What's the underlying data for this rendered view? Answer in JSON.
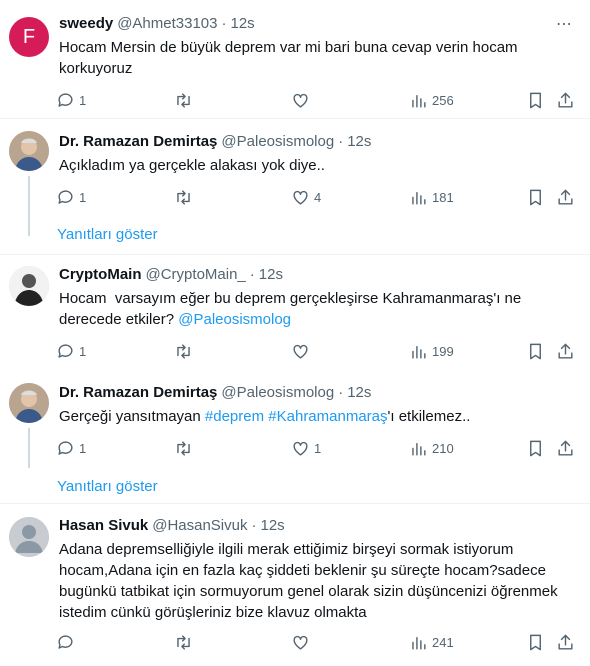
{
  "tweets": [
    {
      "name": "sweedy",
      "handle": "@Ahmet33103",
      "time": "12s",
      "avatar_letter": "F",
      "text_lines": [
        "Hocam Mersin de büyük deprem var mi bari buna cevap verin hocam",
        "korkuyoruz"
      ],
      "replies": "1",
      "retweets": "",
      "likes": "",
      "views": "256"
    },
    {
      "name": "Dr. Ramazan Demirtaş",
      "handle": "@Paleosismolog",
      "time": "12s",
      "text": "Açıkladım ya gerçekle alakası yok diye..",
      "replies": "1",
      "retweets": "",
      "likes": "4",
      "views": "181"
    },
    {
      "name": "CryptoMain",
      "handle": "@CryptoMain_",
      "time": "12s",
      "text_line1": "Hocam  varsayım eğer bu deprem gerçekleşirse Kahramanmaraş'ı ne",
      "text_line2": "derecede etkiler? ",
      "mention": "@Paleosismolog",
      "replies": "1",
      "retweets": "",
      "likes": "",
      "views": "199"
    },
    {
      "name": "Dr. Ramazan Demirtaş",
      "handle": "@Paleosismolog",
      "time": "12s",
      "text_before": "Gerçeği yansıtmayan ",
      "hashtag1": "#deprem",
      "hashtag2": "#Kahramanmaraş",
      "text_after": "'ı etkilemez..",
      "replies": "1",
      "retweets": "",
      "likes": "1",
      "views": "210"
    },
    {
      "name": "Hasan Sivuk",
      "handle": "@HasanSivuk",
      "time": "12s",
      "text_lines": [
        "Adana depremselliğiyle ilgili merak ettiğimiz birşeyi sormak istiyorum",
        "hocam,Adana için en fazla kaç şiddeti beklenir şu süreçte hocam?sadece",
        "bugünkü tatbikat için sormuyorum genel olarak sizin düşüncenizi öğrenmek",
        "istedim cünkü görüşleriniz bize klavuz olmakta"
      ],
      "replies": "",
      "retweets": "",
      "likes": "",
      "views": "241"
    }
  ],
  "show_replies_label": "Yanıtları göster",
  "dot": "·",
  "more_glyph": "⋯",
  "colors": {
    "link": "#1d9bf0",
    "muted": "#536471",
    "avatar_letter_bg": "#d61c58"
  }
}
